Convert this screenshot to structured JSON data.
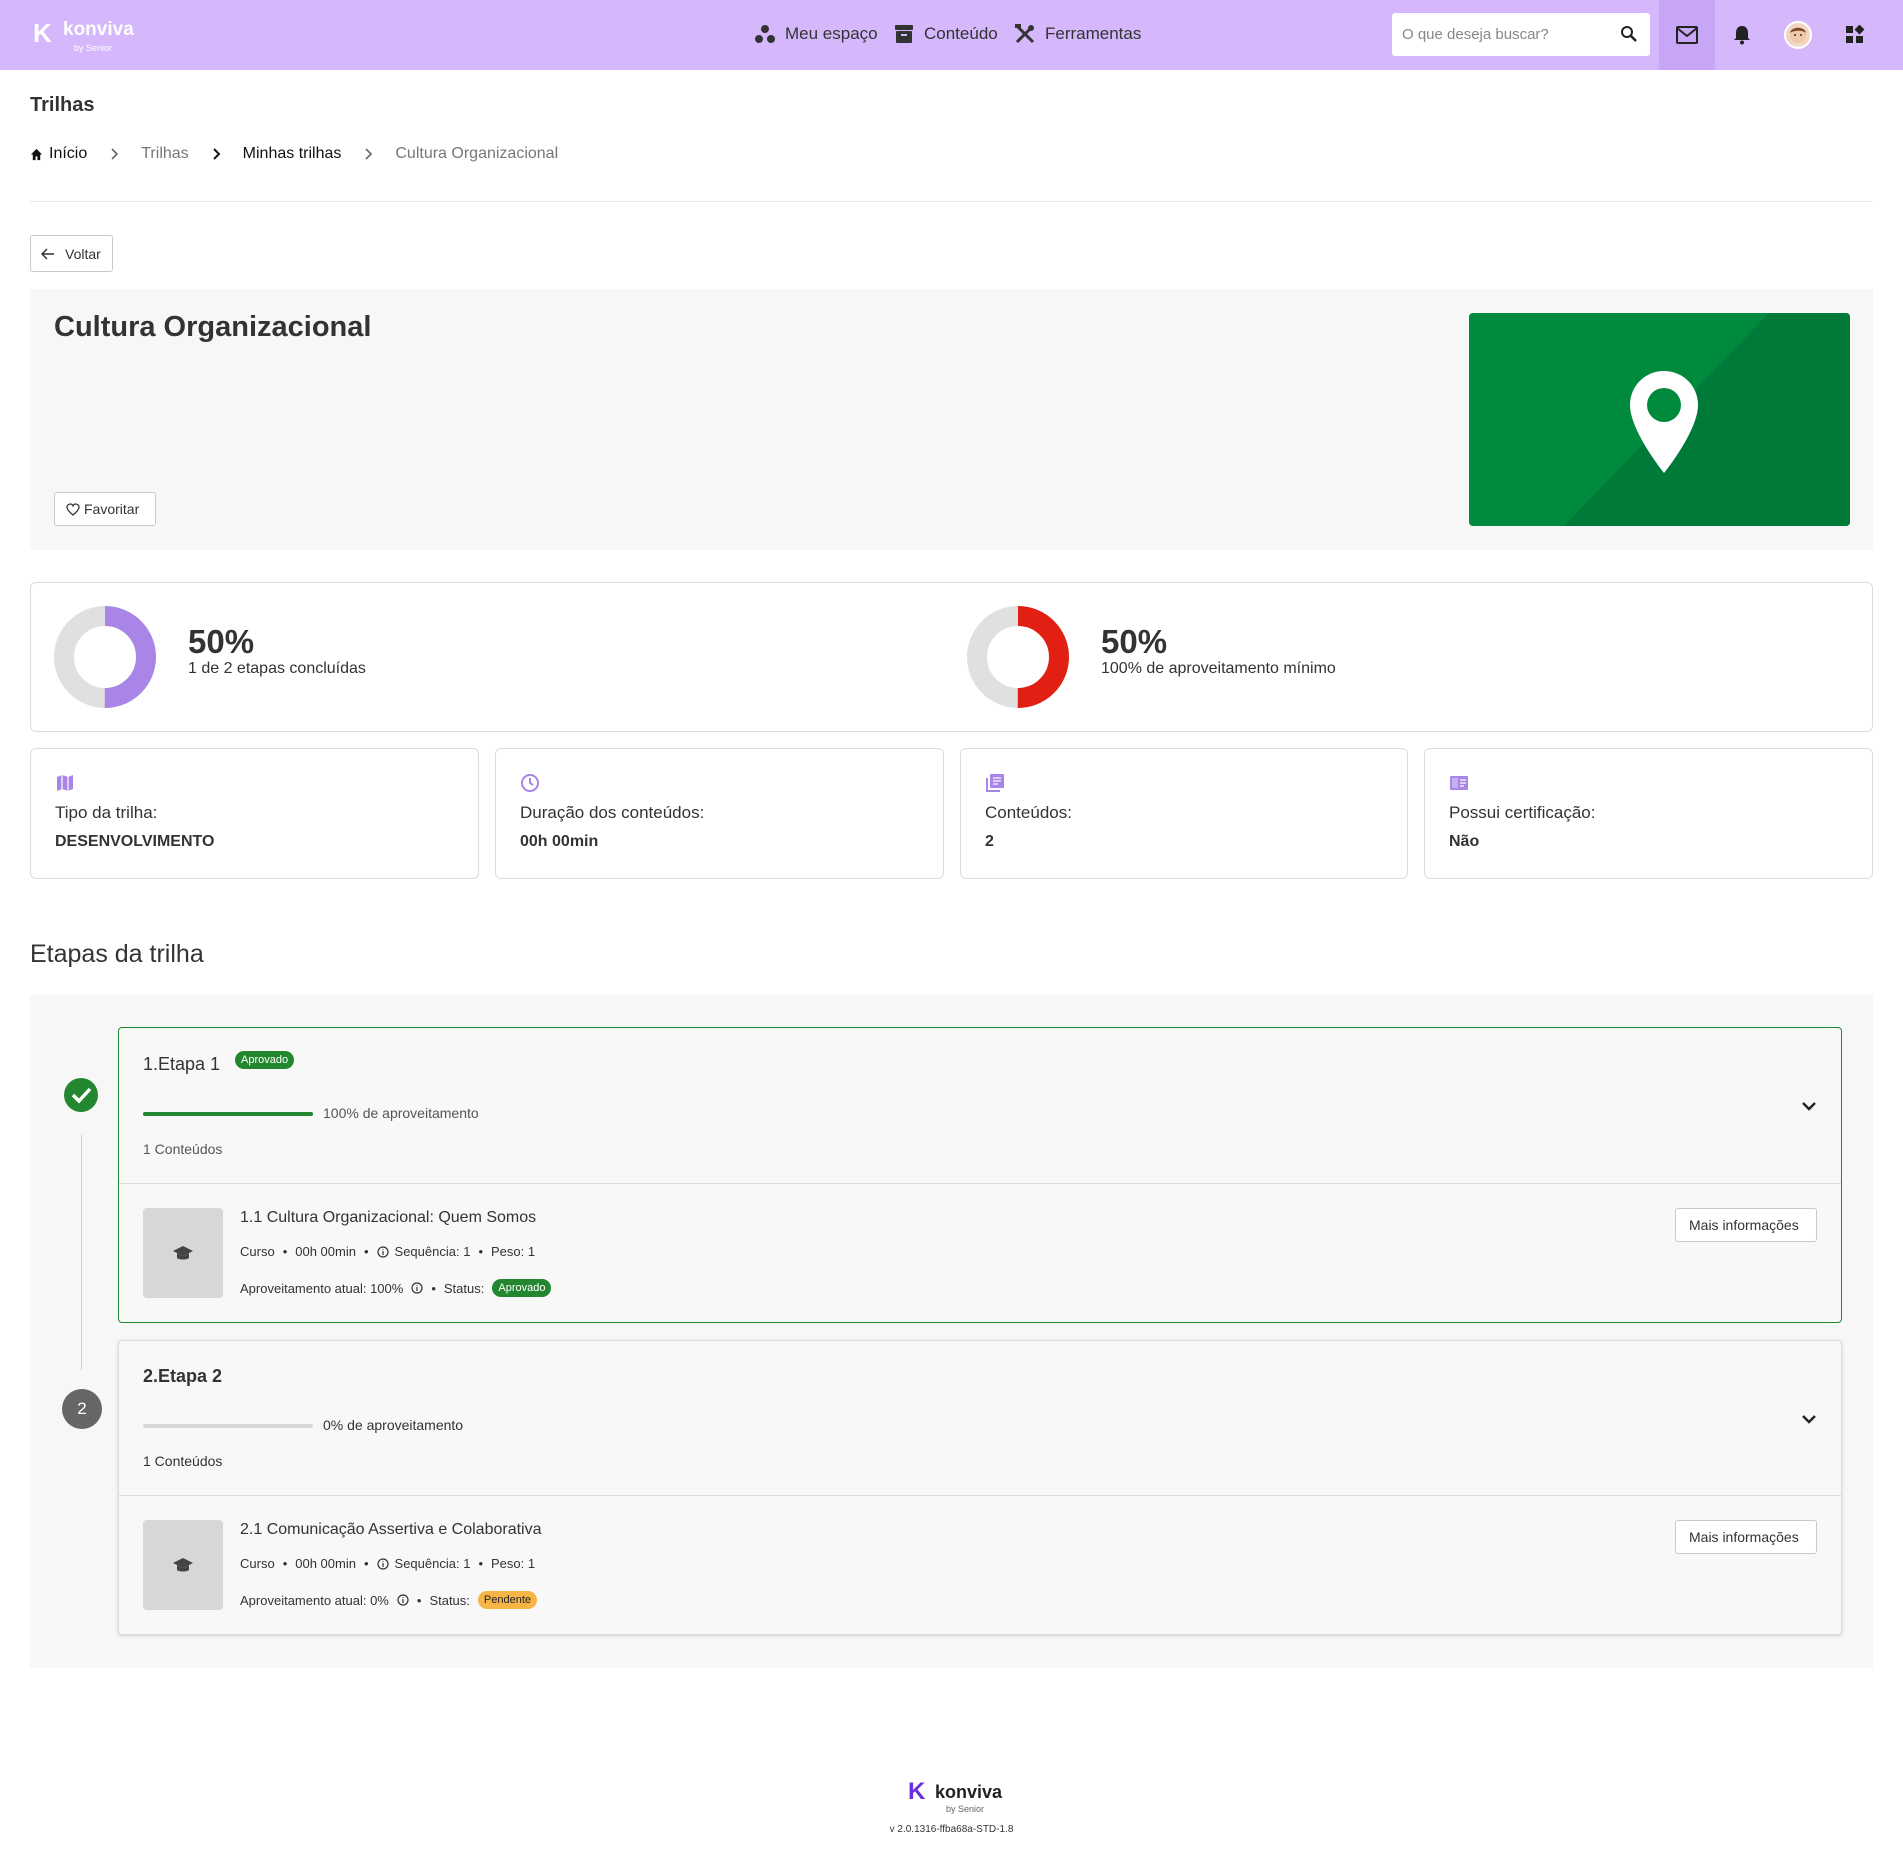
{
  "header": {
    "logo_text": "konviva",
    "logo_by": "by Senior",
    "nav": [
      {
        "label": "Meu espaço",
        "icon": "people-dots-icon"
      },
      {
        "label": "Conteúdo",
        "icon": "archive-box-icon"
      },
      {
        "label": "Ferramentas",
        "icon": "tools-icon"
      }
    ],
    "search_placeholder": "O que deseja buscar?"
  },
  "page": {
    "title": "Trilhas",
    "breadcrumb": [
      "Início",
      "Trilhas",
      "Minhas trilhas",
      "Cultura Organizacional"
    ],
    "back_label": "Voltar"
  },
  "trail": {
    "title": "Cultura Organizacional",
    "favorite_label": "Favoritar",
    "image_color": "#008a3e"
  },
  "progress": {
    "completion": {
      "value": 0.5,
      "label": "50%",
      "subtitle": "1 de 2 etapas concluídas",
      "color": "#a885e6"
    },
    "performance": {
      "value": 0.5,
      "label": "50%",
      "subtitle": "100% de aproveitamento mínimo",
      "color": "#e11f12"
    }
  },
  "info_cards": [
    {
      "icon": "map-icon",
      "label": "Tipo da trilha:",
      "value": "DESENVOLVIMENTO"
    },
    {
      "icon": "clock-icon",
      "label": "Duração dos conteúdos:",
      "value": "00h 00min"
    },
    {
      "icon": "library-icon",
      "label": "Conteúdos:",
      "value": "2"
    },
    {
      "icon": "certificate-icon",
      "label": "Possui certificação:",
      "value": "Não"
    }
  ],
  "steps_title": "Etapas da trilha",
  "steps": [
    {
      "marker": "",
      "title": "1.Etapa 1",
      "badge": "Aprovado",
      "progress": 1.0,
      "progress_label": "100% de aproveitamento",
      "count": "1 Conteúdos",
      "item": {
        "title": "1.1 Cultura Organizacional: Quem Somos",
        "type": "Curso",
        "duration": "00h 00min",
        "sequence": "Sequência: 1",
        "weight": "Peso: 1",
        "performance": "Aproveitamento atual: 100%",
        "status_label": "Status:",
        "status": "Aprovado",
        "more_label": "Mais informações"
      }
    },
    {
      "marker": "2",
      "title": "2.Etapa 2",
      "badge": "",
      "progress": 0.0,
      "progress_label": "0% de aproveitamento",
      "count": "1 Conteúdos",
      "item": {
        "title": "2.1 Comunicação Assertiva e Colaborativa",
        "type": "Curso",
        "duration": "00h 00min",
        "sequence": "Sequência: 1",
        "weight": "Peso: 1",
        "performance": "Aproveitamento atual: 0%",
        "status_label": "Status:",
        "status": "Pendente",
        "more_label": "Mais informações"
      }
    }
  ],
  "colors": {
    "accent": "#d4b8fb",
    "approved": "#23872f",
    "pending": "#f7b548"
  },
  "footer": {
    "logo_text": "konviva",
    "logo_by": "by Senior",
    "version": "v 2.0.1316-ffba68a-STD-1.8"
  }
}
